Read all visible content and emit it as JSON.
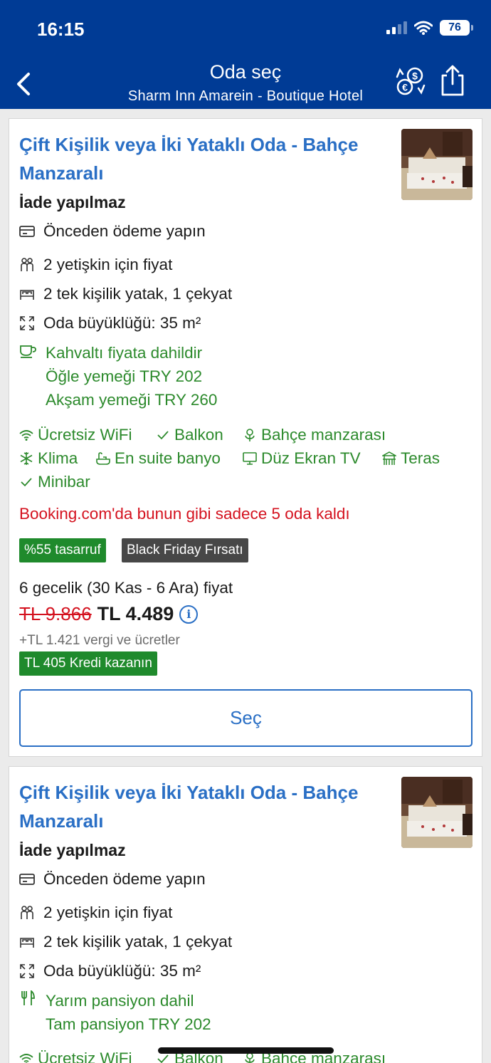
{
  "status_bar": {
    "time": "16:15",
    "battery": "76"
  },
  "nav": {
    "title": "Oda seç",
    "subtitle": "Sharm Inn Amarein - Boutique Hotel"
  },
  "cards": [
    {
      "title": "Çift Kişilik veya İki Yataklı Oda - Bahçe Manzaralı",
      "policy": "İade yapılmaz",
      "details": {
        "payment": "Önceden ödeme yapın",
        "guests": "2 yetişkin için fiyat",
        "beds": "2 tek kişilik yatak, 1 çekyat",
        "size": "Oda büyüklüğü: 35 m²"
      },
      "meals": [
        "Kahvaltı fiyata dahildir",
        "Öğle yemeği TRY 202",
        "Akşam yemeği TRY 260"
      ],
      "facilities": [
        "Ücretsiz WiFi",
        "Balkon",
        "Bahçe manzarası",
        "Klima",
        "En suite banyo",
        "Düz Ekran TV",
        "Teras",
        "Minibar"
      ],
      "scarcity": "Booking.com'da bunun gibi sadece 5 oda kaldı",
      "badges": [
        "%55 tasarruf",
        "Black Friday Fırsatı"
      ],
      "nights": "6 gecelik (30 Kas - 6 Ara) fiyat",
      "old_price": "TL 9.866",
      "new_price": "TL 4.489",
      "taxes": "+TL 1.421 vergi ve ücretler",
      "credit": "TL 405 Kredi kazanın",
      "select_label": "Seç"
    },
    {
      "title": "Çift Kişilik veya İki Yataklı Oda - Bahçe Manzaralı",
      "policy": "İade yapılmaz",
      "details": {
        "payment": "Önceden ödeme yapın",
        "guests": "2 yetişkin için fiyat",
        "beds": "2 tek kişilik yatak, 1 çekyat",
        "size": "Oda büyüklüğü: 35 m²"
      },
      "meals": [
        "Yarım pansiyon dahil",
        "Tam pansiyon TRY 202"
      ],
      "facilities": [
        "Ücretsiz WiFi",
        "Balkon",
        "Bahçe manzarası"
      ]
    }
  ],
  "colors": {
    "header": "#003b95",
    "link": "#2a6fc5",
    "green": "#2c8a2c",
    "red": "#d4111e"
  }
}
